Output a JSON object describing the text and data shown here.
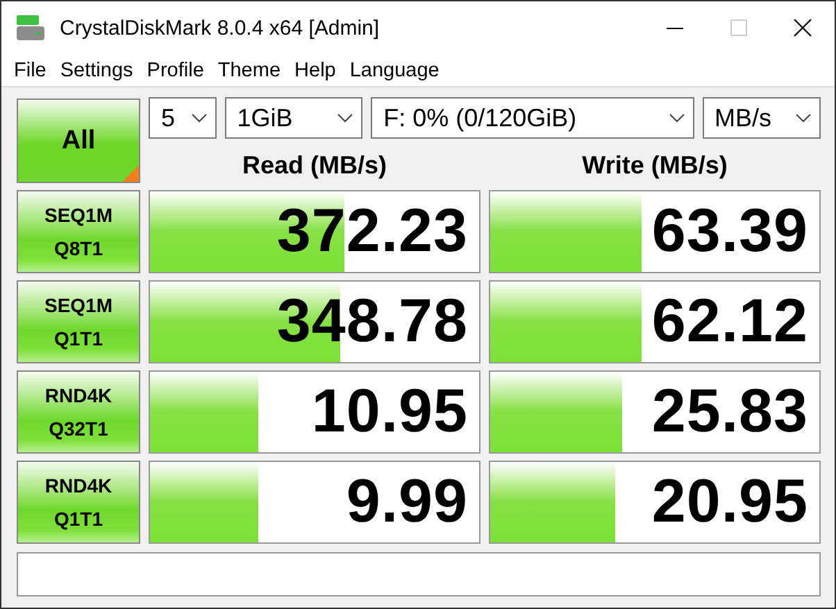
{
  "window": {
    "title": "CrystalDiskMark 8.0.4 x64 [Admin]"
  },
  "menu": [
    "File",
    "Settings",
    "Profile",
    "Theme",
    "Help",
    "Language"
  ],
  "all_button": {
    "label": "All"
  },
  "selects": [
    {
      "value": "5"
    },
    {
      "value": "1GiB"
    },
    {
      "value": "F: 0% (0/120GiB)"
    },
    {
      "value": "MB/s"
    }
  ],
  "columns": [
    "Read (MB/s)",
    "Write (MB/s)"
  ],
  "tests": [
    {
      "label": [
        "SEQ1M",
        "Q8T1"
      ],
      "read": {
        "value": "372.23",
        "level": 0.59
      },
      "write": {
        "value": "63.39",
        "level": 0.46
      }
    },
    {
      "label": [
        "SEQ1M",
        "Q1T1"
      ],
      "read": {
        "value": "348.78",
        "level": 0.58
      },
      "write": {
        "value": "62.12",
        "level": 0.46
      }
    },
    {
      "label": [
        "RND4K",
        "Q32T1"
      ],
      "read": {
        "value": "10.95",
        "level": 0.33
      },
      "write": {
        "value": "25.83",
        "level": 0.4
      }
    },
    {
      "label": [
        "RND4K",
        "Q1T1"
      ],
      "read": {
        "value": "9.99",
        "level": 0.33
      },
      "write": {
        "value": "20.95",
        "level": 0.38
      }
    }
  ]
}
